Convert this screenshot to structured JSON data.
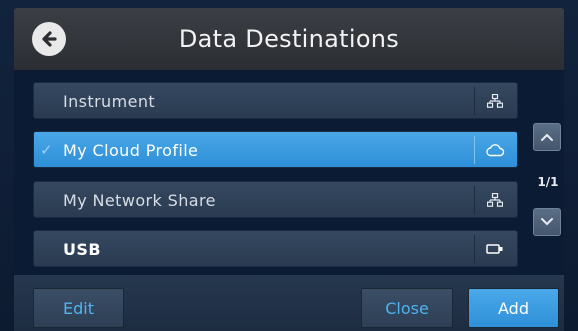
{
  "header": {
    "title": "Data Destinations",
    "back_icon": "arrow-left-circle-icon"
  },
  "destinations": [
    {
      "label": "Instrument",
      "icon": "network-icon",
      "selected": false
    },
    {
      "label": "My Cloud Profile",
      "icon": "cloud-icon",
      "selected": true
    },
    {
      "label": "My Network Share",
      "icon": "network-icon",
      "selected": false
    },
    {
      "label": "USB",
      "icon": "usb-icon",
      "selected": false
    }
  ],
  "selected_mark": "✓",
  "pagination": {
    "indicator": "1/1"
  },
  "footer": {
    "edit": "Edit",
    "close": "Close",
    "add": "Add"
  },
  "colors": {
    "accent": "#2e90d8",
    "link": "#4fb3ef",
    "background": "#0b1b34"
  }
}
